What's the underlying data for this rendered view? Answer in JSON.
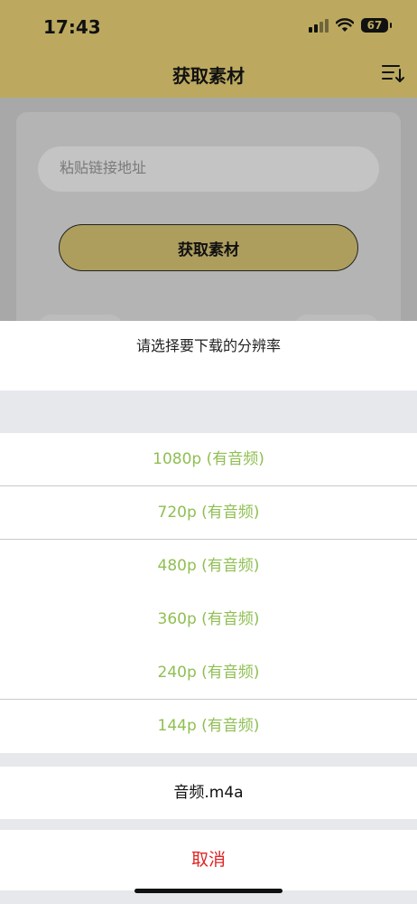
{
  "status_bar": {
    "time": "17:43",
    "battery": "67"
  },
  "nav": {
    "title": "获取素材"
  },
  "form": {
    "placeholder": "粘贴链接地址",
    "fetch_label": "获取素材"
  },
  "sheet": {
    "title": "请选择要下载的分辨率",
    "options": [
      "1080p (有音频)",
      "720p (有音频)",
      "480p (有音频)",
      "360p (有音频)",
      "240p (有音频)",
      "144p (有音频)"
    ],
    "audio_option": "音频.m4a",
    "cancel_label": "取消"
  },
  "colors": {
    "accent": "#bca95f",
    "option_text": "#8fbf52",
    "cancel_text": "#e02424"
  }
}
